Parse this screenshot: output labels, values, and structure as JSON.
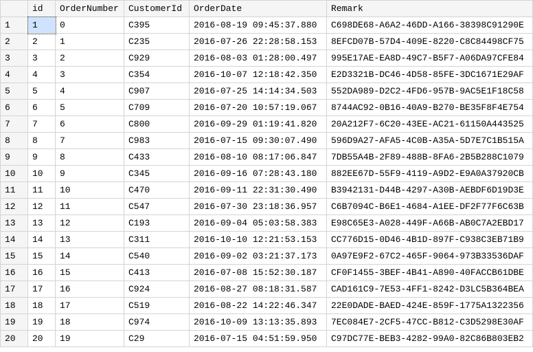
{
  "columns": [
    "id",
    "OrderNumber",
    "CustomerId",
    "OrderDate",
    "Remark"
  ],
  "selected": {
    "row": 0,
    "col": 0
  },
  "rows": [
    {
      "n": "1",
      "id": "1",
      "OrderNumber": "0",
      "CustomerId": "C395",
      "OrderDate": "2016-08-19 09:45:37.880",
      "Remark": "C698DE68-A6A2-46DD-A166-38398C91290E"
    },
    {
      "n": "2",
      "id": "2",
      "OrderNumber": "1",
      "CustomerId": "C235",
      "OrderDate": "2016-07-26 22:28:58.153",
      "Remark": "8EFCD07B-57D4-409E-8220-C8C84498CF75"
    },
    {
      "n": "3",
      "id": "3",
      "OrderNumber": "2",
      "CustomerId": "C929",
      "OrderDate": "2016-08-03 01:28:00.497",
      "Remark": "995E17AE-EA8D-49C7-B5F7-A06DA97CFE84"
    },
    {
      "n": "4",
      "id": "4",
      "OrderNumber": "3",
      "CustomerId": "C354",
      "OrderDate": "2016-10-07 12:18:42.350",
      "Remark": "E2D3321B-DC46-4D58-85FE-3DC1671E29AF"
    },
    {
      "n": "5",
      "id": "5",
      "OrderNumber": "4",
      "CustomerId": "C907",
      "OrderDate": "2016-07-25 14:14:34.503",
      "Remark": "552DA989-D2C2-4FD6-957B-9AC5E1F18C58"
    },
    {
      "n": "6",
      "id": "6",
      "OrderNumber": "5",
      "CustomerId": "C709",
      "OrderDate": "2016-07-20 10:57:19.067",
      "Remark": "8744AC92-0B16-40A9-B270-BE35F8F4E754"
    },
    {
      "n": "7",
      "id": "7",
      "OrderNumber": "6",
      "CustomerId": "C800",
      "OrderDate": "2016-09-29 01:19:41.820",
      "Remark": "20A212F7-6C20-43EE-AC21-61150A443525"
    },
    {
      "n": "8",
      "id": "8",
      "OrderNumber": "7",
      "CustomerId": "C983",
      "OrderDate": "2016-07-15 09:30:07.490",
      "Remark": "596D9A27-AFA5-4C0B-A35A-5D7E7C1B515A"
    },
    {
      "n": "9",
      "id": "9",
      "OrderNumber": "8",
      "CustomerId": "C433",
      "OrderDate": "2016-08-10 08:17:06.847",
      "Remark": "7DB55A4B-2F89-488B-8FA6-2B5B288C1079"
    },
    {
      "n": "10",
      "id": "10",
      "OrderNumber": "9",
      "CustomerId": "C345",
      "OrderDate": "2016-09-16 07:28:43.180",
      "Remark": "882EE67D-55F9-4119-A9D2-E9A0A37920CB"
    },
    {
      "n": "11",
      "id": "11",
      "OrderNumber": "10",
      "CustomerId": "C470",
      "OrderDate": "2016-09-11 22:31:30.490",
      "Remark": "B3942131-D44B-4297-A30B-AEBDF6D19D3E"
    },
    {
      "n": "12",
      "id": "12",
      "OrderNumber": "11",
      "CustomerId": "C547",
      "OrderDate": "2016-07-30 23:18:36.957",
      "Remark": "C6B7094C-B6E1-4684-A1EE-DF2F77F6C63B"
    },
    {
      "n": "13",
      "id": "13",
      "OrderNumber": "12",
      "CustomerId": "C193",
      "OrderDate": "2016-09-04 05:03:58.383",
      "Remark": "E98C65E3-A028-449F-A66B-AB0C7A2EBD17"
    },
    {
      "n": "14",
      "id": "14",
      "OrderNumber": "13",
      "CustomerId": "C311",
      "OrderDate": "2016-10-10 12:21:53.153",
      "Remark": "CC776D15-0D46-4B1D-897F-C938C3EB71B9"
    },
    {
      "n": "15",
      "id": "15",
      "OrderNumber": "14",
      "CustomerId": "C540",
      "OrderDate": "2016-09-02 03:21:37.173",
      "Remark": "0A97E9F2-67C2-465F-9064-973B33536DAF"
    },
    {
      "n": "16",
      "id": "16",
      "OrderNumber": "15",
      "CustomerId": "C413",
      "OrderDate": "2016-07-08 15:52:30.187",
      "Remark": "CF0F1455-3BEF-4B41-A890-40FACCB61DBE"
    },
    {
      "n": "17",
      "id": "17",
      "OrderNumber": "16",
      "CustomerId": "C924",
      "OrderDate": "2016-08-27 08:18:31.587",
      "Remark": "CAD161C9-7E53-4FF1-8242-D3LC5B364BEA"
    },
    {
      "n": "18",
      "id": "18",
      "OrderNumber": "17",
      "CustomerId": "C519",
      "OrderDate": "2016-08-22 14:22:46.347",
      "Remark": "22E0DADE-BAED-424E-859F-1775A1322356"
    },
    {
      "n": "19",
      "id": "19",
      "OrderNumber": "18",
      "CustomerId": "C974",
      "OrderDate": "2016-10-09 13:13:35.893",
      "Remark": "7EC084E7-2CF5-47CC-B812-C3D5298E30AF"
    },
    {
      "n": "20",
      "id": "20",
      "OrderNumber": "19",
      "CustomerId": "C29",
      "OrderDate": "2016-07-15 04:51:59.950",
      "Remark": "C97DC77E-BEB3-4282-99A0-82C86B803EB2"
    }
  ]
}
